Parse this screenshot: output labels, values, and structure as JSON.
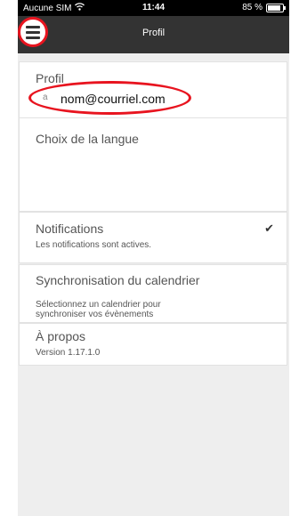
{
  "status": {
    "carrier": "Aucune SIM",
    "time": "11:44",
    "battery": "85 %",
    "battery_level": 0.85
  },
  "nav": {
    "title": "Profil"
  },
  "profile": {
    "title": "Profil",
    "email": "nom@courriel.com",
    "email_prefix": "a"
  },
  "language": {
    "title": "Choix de la langue"
  },
  "notifications": {
    "title": "Notifications",
    "subtitle": "Les notifications sont actives.",
    "checkmark": "✔"
  },
  "calendar": {
    "title": "Synchronisation du calendrier",
    "subtitle_line1": "Sélectionnez un calendrier pour",
    "subtitle_line2": "synchroniser vos évènements"
  },
  "about": {
    "title": "À propos",
    "version": "Version 1.17.1.0"
  },
  "colors": {
    "highlight": "#e8141f",
    "navbar": "#333333",
    "background": "#eeeeee"
  }
}
